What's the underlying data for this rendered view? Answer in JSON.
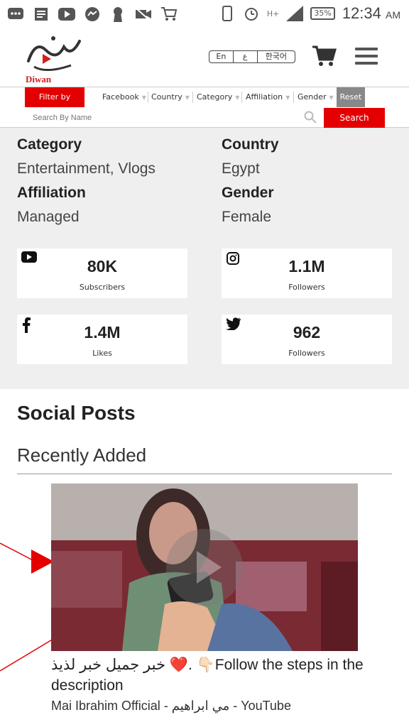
{
  "status_bar": {
    "battery": "35%",
    "time": "12:34",
    "ampm": "AM",
    "network": "H+"
  },
  "header": {
    "logo_text": "Diwan",
    "languages": [
      "En",
      "ع",
      "한국어"
    ]
  },
  "filter_bar": {
    "filter_by_label": "Filter by",
    "filters": [
      "Facebook",
      "Country",
      "Category",
      "Affiliation",
      "Gender"
    ],
    "reset_label": "Reset",
    "search_placeholder": "Search By Name",
    "search_button": "Search"
  },
  "profile_info": {
    "category_label": "Category",
    "category_value": "Entertainment, Vlogs",
    "country_label": "Country",
    "country_value": "Egypt",
    "affiliation_label": "Affiliation",
    "affiliation_value": "Managed",
    "gender_label": "Gender",
    "gender_value": "Female"
  },
  "stats": [
    {
      "platform": "youtube",
      "value": "80K",
      "label": "Subscribers"
    },
    {
      "platform": "instagram",
      "value": "1.1M",
      "label": "Followers"
    },
    {
      "platform": "facebook",
      "value": "1.4M",
      "label": "Likes"
    },
    {
      "platform": "twitter",
      "value": "962",
      "label": "Followers"
    }
  ],
  "social_posts": {
    "title": "Social Posts",
    "subtitle": "Recently Added",
    "post": {
      "title": "خبر جميل خبر لذيذ ❤️. 👇🏻Follow the steps in the description",
      "source": "Mai Ibrahim Official - مي ابراهيم - YouTube"
    }
  },
  "colors": {
    "accent": "#e40000",
    "reset": "#888888",
    "info_bg": "#efefef"
  }
}
